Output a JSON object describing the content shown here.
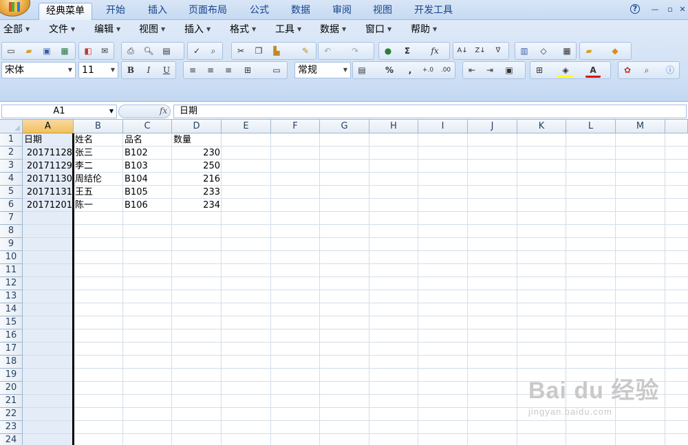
{
  "ribbon_tabs": [
    "经典菜单",
    "开始",
    "插入",
    "页面布局",
    "公式",
    "数据",
    "审阅",
    "视图",
    "开发工具"
  ],
  "classic_menus": [
    "全部",
    "文件",
    "编辑",
    "视图",
    "插入",
    "格式",
    "工具",
    "数据",
    "窗口",
    "帮助"
  ],
  "format_bar": {
    "font_name": "宋体",
    "font_size": "11",
    "number_format": "常规",
    "bold": "B",
    "italic": "I",
    "underline": "U",
    "percent": "%",
    "comma": ","
  },
  "window_controls": {
    "help": "?",
    "restore": "▫",
    "close": "✕"
  },
  "formula_bar": {
    "name_box": "A1",
    "fx": "fx",
    "content": "日期"
  },
  "column_headers": [
    "A",
    "B",
    "C",
    "D",
    "E",
    "F",
    "G",
    "H",
    "I",
    "J",
    "K",
    "L",
    "M"
  ],
  "row_numbers": [
    "1",
    "2",
    "3",
    "4",
    "5",
    "6",
    "7",
    "8",
    "9",
    "10",
    "11",
    "12",
    "13",
    "14",
    "15",
    "16",
    "17",
    "18",
    "19",
    "20",
    "21",
    "22",
    "23",
    "24"
  ],
  "sheet": {
    "header": [
      "日期",
      "姓名",
      "品名",
      "数量"
    ],
    "rows": [
      [
        "20171128",
        "张三",
        "B102",
        "230"
      ],
      [
        "20171129",
        "李二",
        "B103",
        "250"
      ],
      [
        "20171130",
        "周结伦",
        "B104",
        "216"
      ],
      [
        "20171131",
        "王五",
        "B105",
        "233"
      ],
      [
        "20171201",
        "陈一",
        "B106",
        "234"
      ]
    ]
  },
  "watermark": {
    "brand": "Bai du 经验",
    "url": "jingyan.baidu.com"
  },
  "colors": {
    "selected_header": "#f1c15f",
    "ribbon": "#cfe0f5",
    "grid_line": "#d3dde9"
  }
}
